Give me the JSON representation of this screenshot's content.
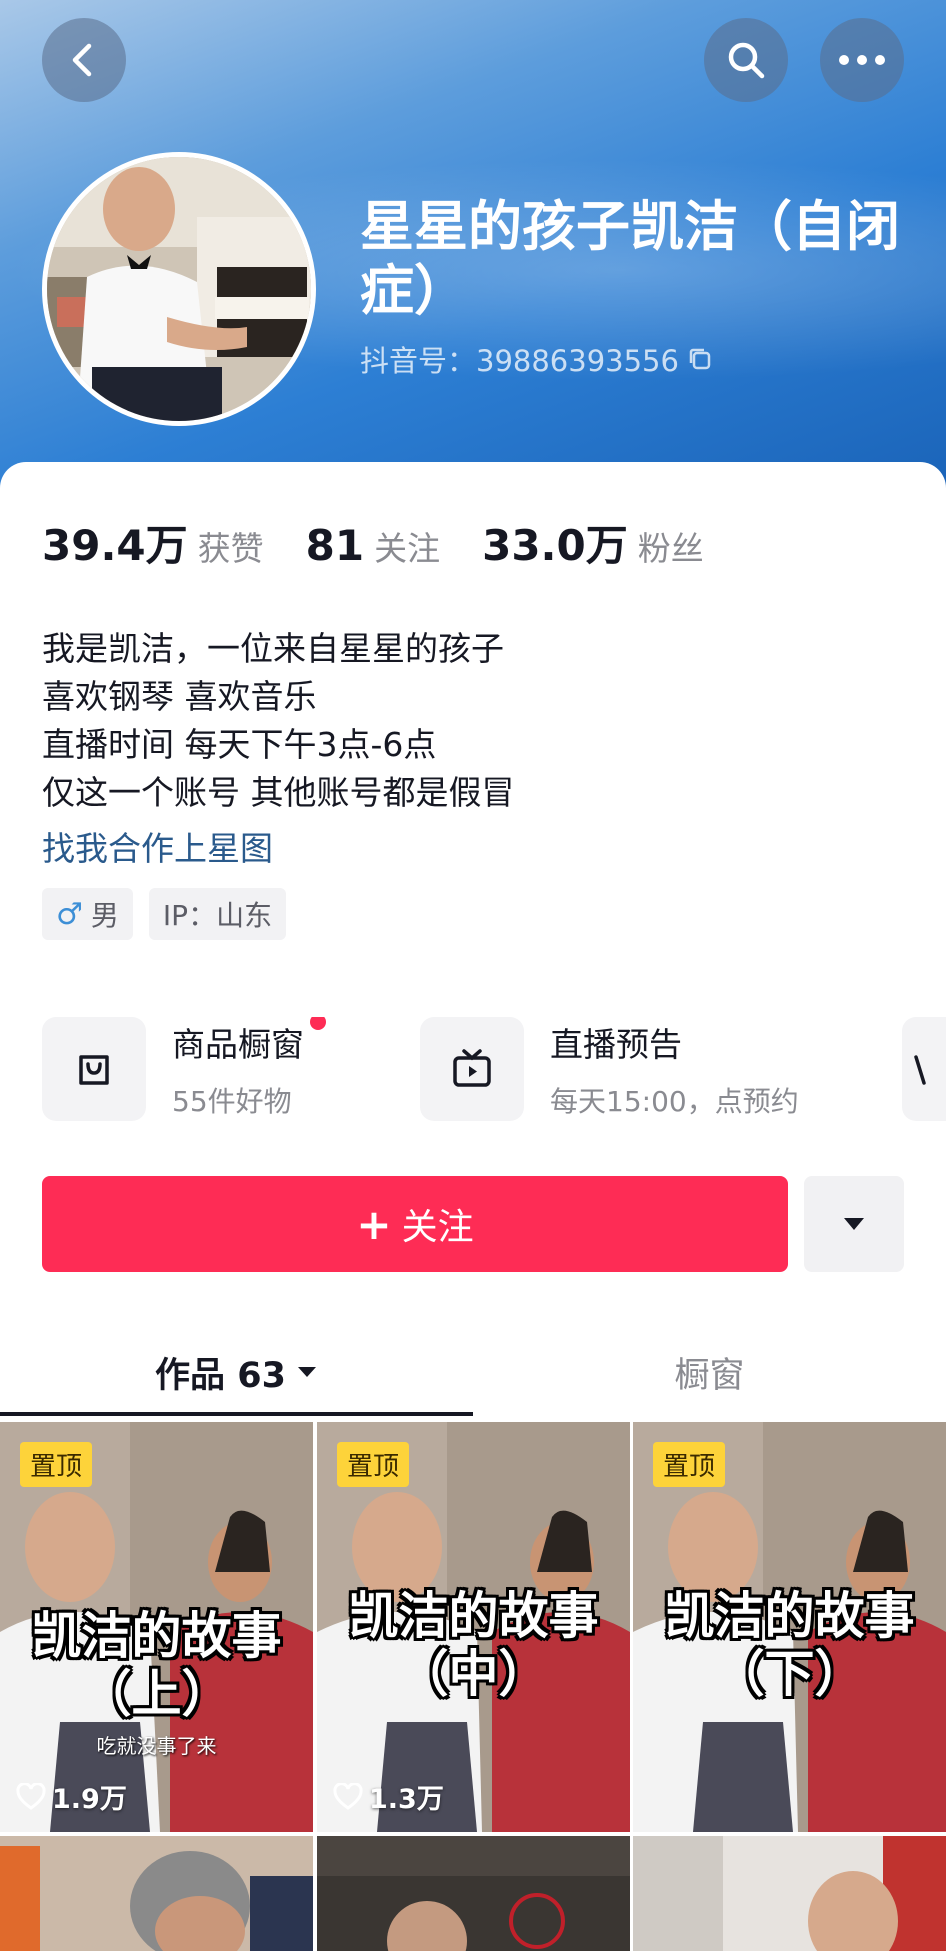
{
  "header": {
    "nickname": "星星的孩子凯洁（自闭症）",
    "douyin_id": "抖音号：39886393556"
  },
  "stats": [
    {
      "value": "39.4万",
      "label": "获赞"
    },
    {
      "value": "81",
      "label": "关注"
    },
    {
      "value": "33.0万",
      "label": "粉丝"
    }
  ],
  "bio": {
    "lines": [
      "我是凯洁，一位来自星星的孩子",
      "喜欢钢琴 喜欢音乐",
      "直播时间 每天下午3点-6点",
      "仅这一个账号 其他账号都是假冒"
    ],
    "link": "找我合作上星图"
  },
  "tags": {
    "gender_symbol": "♂",
    "gender": "男",
    "ip": "IP：山东"
  },
  "services": [
    {
      "title": "商品橱窗",
      "subtitle": "55件好物",
      "icon": "shopping-bag-icon"
    },
    {
      "title": "直播预告",
      "subtitle": "每天15:00，点预约",
      "icon": "tv-icon"
    }
  ],
  "actions": {
    "follow_plus": "+",
    "follow_label": "关注"
  },
  "tabs": [
    {
      "label": "作品 63"
    },
    {
      "label": "橱窗"
    }
  ],
  "videos": [
    {
      "pinned": "置顶",
      "title_line1": "凯洁的故事",
      "title_line2": "（上）",
      "caption": "吃就没事了来",
      "likes": "1.9万"
    },
    {
      "pinned": "置顶",
      "title_line1": "凯洁的故事",
      "title_line2": "（中）",
      "caption": "",
      "likes": "1.3万"
    },
    {
      "pinned": "置顶",
      "title_line1": "凯洁的故事",
      "title_line2": "（下）",
      "caption": "",
      "likes": ""
    }
  ],
  "colors": {
    "accent": "#fe2c55",
    "link": "#2a5a8c",
    "pin": "#fdd33a"
  }
}
